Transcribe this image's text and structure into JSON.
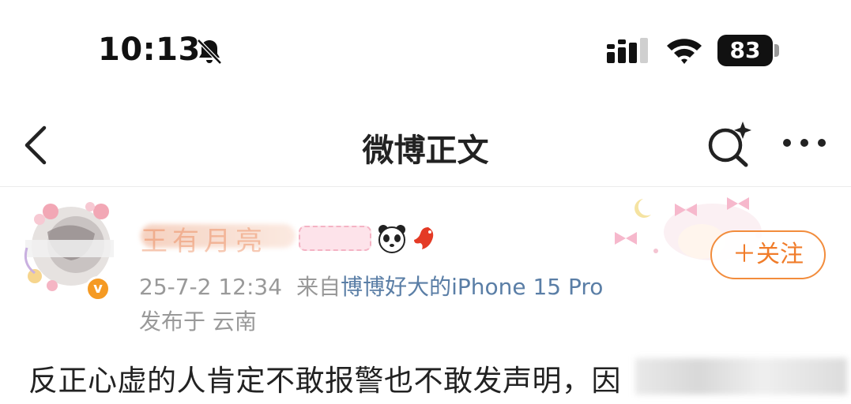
{
  "status_bar": {
    "time": "10:13",
    "battery": "83",
    "icons": [
      "bell-slash-icon",
      "cellular-signal-icon",
      "wifi-icon",
      "battery-icon"
    ]
  },
  "nav": {
    "title": "微博正文",
    "icons": [
      "chevron-left-icon",
      "sparkle-search-icon",
      "more-horizontal-icon"
    ]
  },
  "post": {
    "username": "王有月亮",
    "verified_badge": "v",
    "follow_label": "＋关注",
    "date": "25-7-2 12:34",
    "source_prefix": "来自",
    "source_device": "博博好大的iPhone 15 Pro",
    "location": "发布于 云南",
    "body_text": "反正心虚的人肯定不敢报警也不敢发声明，因"
  },
  "colors": {
    "accent_orange": "#f07c2a",
    "source_blue": "#5a7ea6",
    "meta_gray": "#999999",
    "verified_badge": "#f59a23"
  }
}
